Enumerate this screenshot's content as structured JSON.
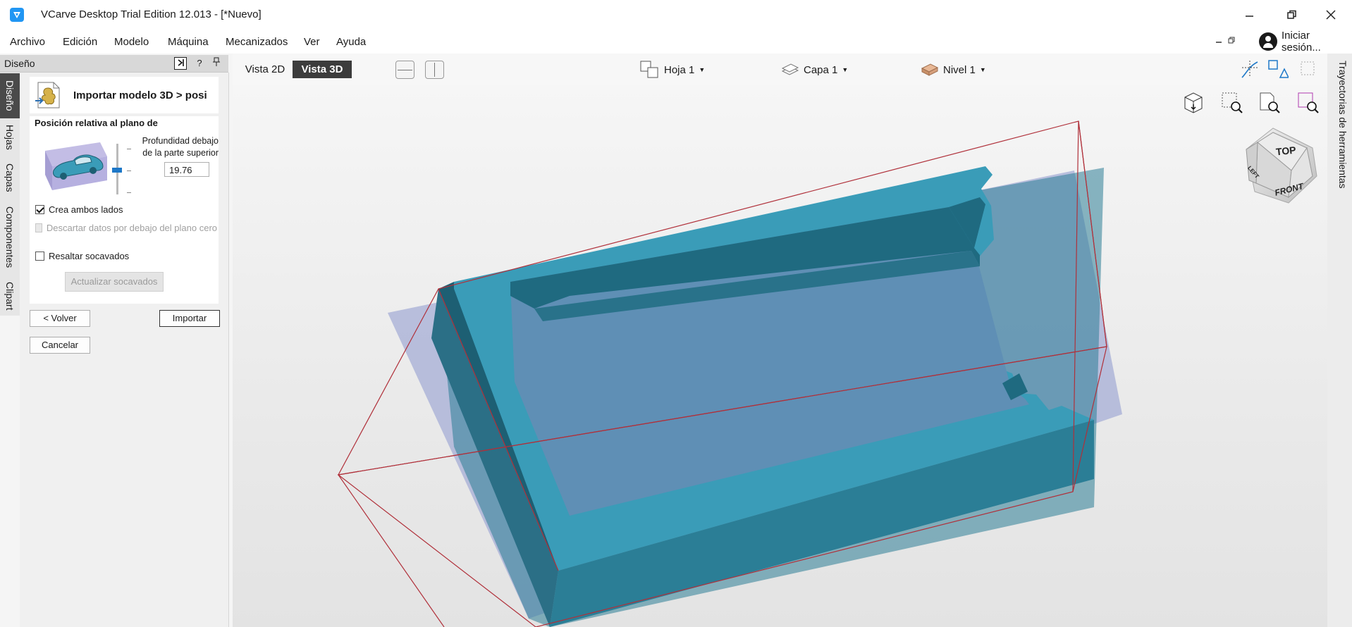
{
  "app": {
    "title": "VCarve Desktop Trial Edition 12.013 - [*Nuevo]"
  },
  "window_controls": [
    "minimize-icon",
    "restore-icon",
    "close-icon"
  ],
  "menu": {
    "items": [
      "Archivo",
      "Edición",
      "Modelo",
      "Máquina",
      "Mecanizados",
      "Ver",
      "Ayuda"
    ],
    "signin": "Iniciar sesión..."
  },
  "left_tabs": {
    "items": [
      "Diseño",
      "Hojas",
      "Capas",
      "Componentes",
      "Clipart"
    ],
    "active": "Diseño"
  },
  "panel": {
    "header": "Diseño",
    "pin_help": "?",
    "title": "Importar modelo 3D > posi",
    "section_label": "Posición relativa al plano de",
    "depth_label": "Profundidad debajo de la parte superior",
    "depth_value": "19.76",
    "create_both_sides": "Crea ambos lados",
    "discard_below": "Descartar datos por debajo del plano cero",
    "highlight_undercuts": "Resaltar socavados",
    "update_undercuts": "Actualizar socavados",
    "back": "< Volver",
    "import": "Importar",
    "cancel": "Cancelar"
  },
  "view": {
    "tab_2d": "Vista 2D",
    "tab_3d": "Vista 3D",
    "sheet": "Hoja 1",
    "layer": "Capa 1",
    "level": "Nivel 1",
    "cube_faces": {
      "top": "TOP",
      "front": "FRONT",
      "left": "LEFT"
    }
  },
  "right_tab": {
    "label": "Trayectorias de herramientas"
  },
  "colors": {
    "accent": "#2196f3",
    "model_top": "#3a9cb8",
    "model_side": "#2b7e96",
    "model_dark": "#1d5f73",
    "bbox": "#b0303a",
    "plane": "#a6aed6"
  }
}
